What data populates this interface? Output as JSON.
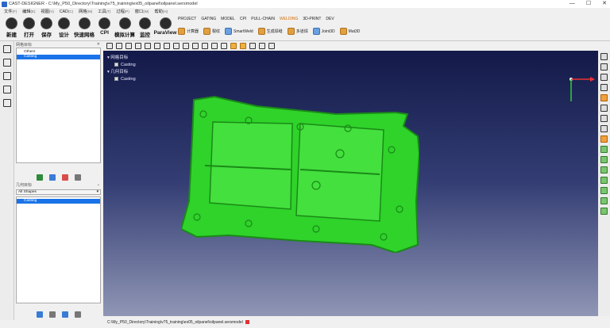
{
  "window": {
    "title": "CAST-DESIGNER - C:\\My_P50_Directory\\Training\\v75_training\\ex05_oilpanel\\oilpanel.sersmodel",
    "controls": [
      "—",
      "☐",
      "✕"
    ]
  },
  "menu": [
    {
      "label": "文件",
      "key": "(F)"
    },
    {
      "label": "编辑",
      "key": "(E)"
    },
    {
      "label": "视图",
      "key": "(V)"
    },
    {
      "label": "CAD",
      "key": "(C)"
    },
    {
      "label": "网格",
      "key": "(M)"
    },
    {
      "label": "工具",
      "key": "(T)"
    },
    {
      "label": "过程",
      "key": "(P)"
    },
    {
      "label": "窗口",
      "key": "(W)"
    },
    {
      "label": "帮助",
      "key": "(H)"
    }
  ],
  "ribbon_tabs": [
    "PROJECT",
    "GATING",
    "MODEL",
    "CPI",
    "PULL-CHAIN",
    "WELDING",
    "3D-PRINT",
    "DEV"
  ],
  "active_tab": "WELDING",
  "big_tools": [
    {
      "label": "新建",
      "icon": "new-file-icon"
    },
    {
      "label": "打开",
      "icon": "open-folder-icon"
    },
    {
      "label": "保存",
      "icon": "save-icon"
    },
    {
      "label": "设计",
      "icon": "design-icon"
    },
    {
      "label": "快速网格",
      "icon": "quick-mesh-icon"
    },
    {
      "label": "CPI",
      "icon": "cpi-icon"
    },
    {
      "label": "模拟计算",
      "icon": "simulation-icon"
    },
    {
      "label": "监控",
      "icon": "monitor-icon"
    },
    {
      "label": "ParaView",
      "icon": "paraview-icon"
    }
  ],
  "ribbon_tools": [
    {
      "label": "计算器",
      "icon": "calculator-icon"
    },
    {
      "label": "裂纹",
      "icon": "crack-icon"
    },
    {
      "label": "SmartWeld",
      "icon": "smartweld-icon"
    },
    {
      "label": "生成焊缝",
      "icon": "generate-weld-icon"
    },
    {
      "label": "多道焊",
      "icon": "multipass-weld-icon"
    },
    {
      "label": "Joint3D",
      "icon": "joint3d-icon"
    },
    {
      "label": "Mat3D",
      "icon": "mat3d-icon"
    }
  ],
  "network_panel": {
    "title": "网格目标",
    "items": [
      "Others",
      "Casting"
    ],
    "selected": "Casting"
  },
  "geometry_panel": {
    "title": "几何目标",
    "filter": "All Shapes",
    "items": [
      "Casting"
    ],
    "selected": "Casting"
  },
  "viewport_tree": [
    {
      "label": "网格目标",
      "children": [
        "Casting"
      ]
    },
    {
      "label": "几何目标",
      "children": [
        "Casting"
      ]
    }
  ],
  "statusbar": {
    "path": "C:\\My_P50_Directory\\Training\\v75_training\\ex05_oilpanel\\oilpanel.sersmodel"
  },
  "colors": {
    "model_green": "#2fd32a",
    "model_edge": "#1a8a17",
    "viewport_top": "#131a49",
    "viewport_bottom": "#8f96b5",
    "active_tab": "#d66a00",
    "selection": "#1a73e8"
  }
}
